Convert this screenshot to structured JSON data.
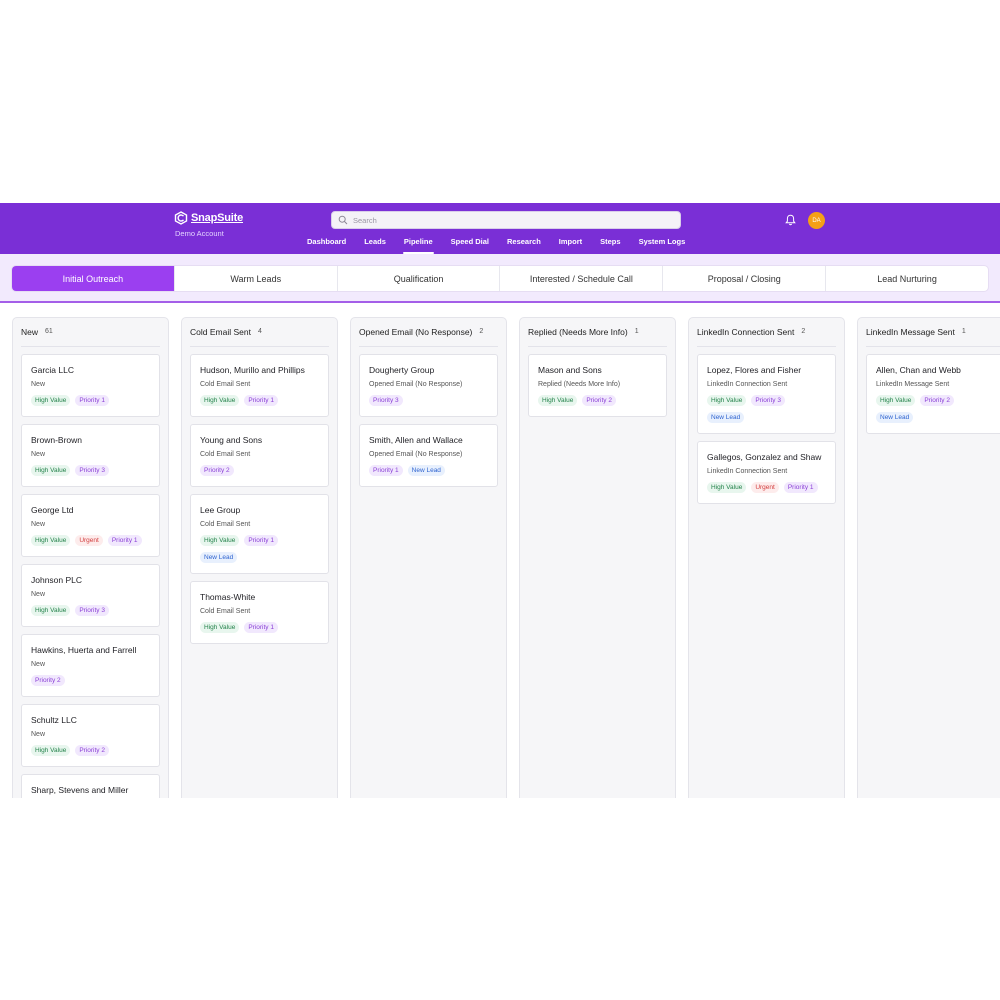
{
  "app": {
    "brand": "SnapSuite",
    "account": "Demo Account",
    "search_placeholder": "Search",
    "avatar_initials": "DA",
    "nav": [
      "Dashboard",
      "Leads",
      "Pipeline",
      "Speed Dial",
      "Research",
      "Import",
      "Steps",
      "System Logs"
    ],
    "nav_active": "Pipeline",
    "colors": {
      "header": "#7a2fd6",
      "active_tab": "#9b3ff0",
      "avatar": "#f5a016"
    }
  },
  "stages": {
    "tabs": [
      "Initial Outreach",
      "Warm Leads",
      "Qualification",
      "Interested / Schedule Call",
      "Proposal / Closing",
      "Lead Nurturing"
    ],
    "active": "Initial Outreach"
  },
  "columns": [
    {
      "title": "New",
      "count": "61",
      "cards": [
        {
          "name": "Garcia LLC",
          "status": "New",
          "tags": [
            "High Value",
            "Priority 1"
          ]
        },
        {
          "name": "Brown-Brown",
          "status": "New",
          "tags": [
            "High Value",
            "Priority 3"
          ]
        },
        {
          "name": "George Ltd",
          "status": "New",
          "tags": [
            "High Value",
            "Urgent",
            "Priority 1"
          ]
        },
        {
          "name": "Johnson PLC",
          "status": "New",
          "tags": [
            "High Value",
            "Priority 3"
          ]
        },
        {
          "name": "Hawkins, Huerta and Farrell",
          "status": "New",
          "tags": [
            "Priority 2"
          ]
        },
        {
          "name": "Schultz LLC",
          "status": "New",
          "tags": [
            "High Value",
            "Priority 2"
          ]
        },
        {
          "name": "Sharp, Stevens and Miller",
          "status": "",
          "tags": []
        }
      ]
    },
    {
      "title": "Cold Email Sent",
      "count": "4",
      "cards": [
        {
          "name": "Hudson, Murillo and Phillips",
          "status": "Cold Email Sent",
          "tags": [
            "High Value",
            "Priority 1"
          ]
        },
        {
          "name": "Young and Sons",
          "status": "Cold Email Sent",
          "tags": [
            "Priority 2"
          ]
        },
        {
          "name": "Lee Group",
          "status": "Cold Email Sent",
          "tags": [
            "High Value",
            "Priority 1"
          ],
          "tags2": [
            "New Lead"
          ]
        },
        {
          "name": "Thomas-White",
          "status": "Cold Email Sent",
          "tags": [
            "High Value",
            "Priority 1"
          ]
        }
      ]
    },
    {
      "title": "Opened Email (No Response)",
      "count": "2",
      "cards": [
        {
          "name": "Dougherty Group",
          "status": "Opened Email (No Response)",
          "tags": [
            "Priority 3"
          ]
        },
        {
          "name": "Smith, Allen and Wallace",
          "status": "Opened Email (No Response)",
          "tags": [
            "Priority 1",
            "New Lead"
          ]
        }
      ]
    },
    {
      "title": "Replied (Needs More Info)",
      "count": "1",
      "cards": [
        {
          "name": "Mason and Sons",
          "status": "Replied (Needs More Info)",
          "tags": [
            "High Value",
            "Priority 2"
          ]
        }
      ]
    },
    {
      "title": "LinkedIn Connection Sent",
      "count": "2",
      "cards": [
        {
          "name": "Lopez, Flores and Fisher",
          "status": "LinkedIn Connection Sent",
          "tags": [
            "High Value",
            "Priority 3"
          ],
          "tags2": [
            "New Lead"
          ]
        },
        {
          "name": "Gallegos, Gonzalez and Shaw",
          "status": "LinkedIn Connection Sent",
          "tags": [
            "High Value",
            "Urgent",
            "Priority 1"
          ]
        }
      ]
    },
    {
      "title": "LinkedIn Message Sent",
      "count": "1",
      "cards": [
        {
          "name": "Allen, Chan and Webb",
          "status": "LinkedIn Message Sent",
          "tags": [
            "High Value",
            "Priority 2"
          ],
          "tags2": [
            "New Lead"
          ]
        }
      ]
    }
  ]
}
